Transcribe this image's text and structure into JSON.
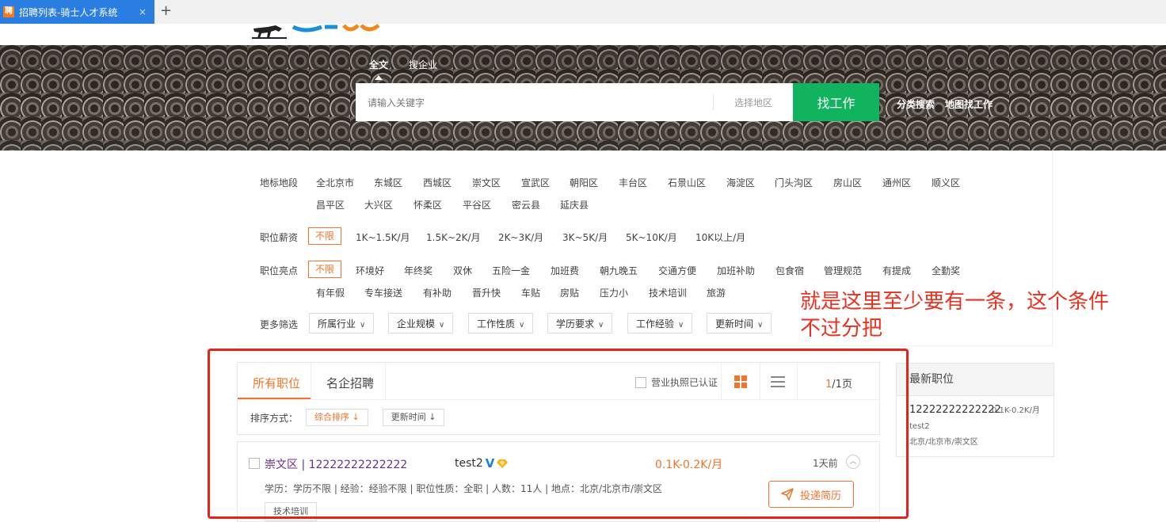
{
  "browser": {
    "tab_favicon": "聘",
    "tab_title": "招聘列表-骑士人才系统",
    "tab_close": "×",
    "new_tab": "+"
  },
  "hero": {
    "search_tabs": [
      "全文",
      "搜企业"
    ],
    "search_placeholder": "请输入关键字",
    "region_label": "选择地区",
    "search_button": "找工作",
    "links": [
      "分类搜索",
      "地图找工作"
    ]
  },
  "filters": {
    "area_label": "地标地段",
    "areas": [
      "全北京市",
      "东城区",
      "西城区",
      "崇文区",
      "宣武区",
      "朝阳区",
      "丰台区",
      "石景山区",
      "海淀区",
      "门头沟区",
      "房山区",
      "通州区",
      "顺义区",
      "昌平区",
      "大兴区",
      "怀柔区",
      "平谷区",
      "密云县",
      "延庆县"
    ],
    "salary_label": "职位薪资",
    "salaries": [
      "不限",
      "1K~1.5K/月",
      "1.5K~2K/月",
      "2K~3K/月",
      "3K~5K/月",
      "5K~10K/月",
      "10K以上/月"
    ],
    "highlight_label": "职位亮点",
    "highlights": [
      "不限",
      "环境好",
      "年终奖",
      "双休",
      "五险一金",
      "加班费",
      "朝九晚五",
      "交通方便",
      "加班补助",
      "包食宿",
      "管理规范",
      "有提成",
      "全勤奖",
      "有年假",
      "专车接送",
      "有补助",
      "晋升快",
      "车贴",
      "房贴",
      "压力小",
      "技术培训",
      "旅游"
    ],
    "more_label": "更多筛选",
    "dropdowns": [
      "所属行业",
      "企业规模",
      "工作性质",
      "学历要求",
      "工作经验",
      "更新时间"
    ]
  },
  "annotation": {
    "line1": "就是这里至少要有一条，这个条件",
    "line2": "不过分把"
  },
  "list": {
    "tabs": [
      "所有职位",
      "名企招聘"
    ],
    "license_filter": "营业执照已认证",
    "page_current": "1",
    "page_total": "/1页",
    "sort_label": "排序方式：",
    "sort_options": [
      "综合排序 ↓",
      "更新时间 ↓"
    ]
  },
  "job": {
    "title": "崇文区 | 12222222222222",
    "company": "test2",
    "verified_mark": "V",
    "salary": "0.1K-0.2K/月",
    "updated": "1天前",
    "meta": "学历：学历不限  |  经验：经验不限  |  职位性质：全职  |  人数：11人  |  地点：北京/北京市/崇文区",
    "apply_button": "投递简历",
    "tag": "技术培训"
  },
  "latest": {
    "heading": "最新职位",
    "title": "12222222222222",
    "salary": "0.1K-0.2K/月",
    "company": "test2",
    "location": "北京/北京市/崇文区"
  },
  "colors": {
    "tab_blue": "#2a7de1",
    "brand_green": "#12b35e",
    "accent_orange": "#f0742b",
    "annotation_red": "#e8321f"
  }
}
